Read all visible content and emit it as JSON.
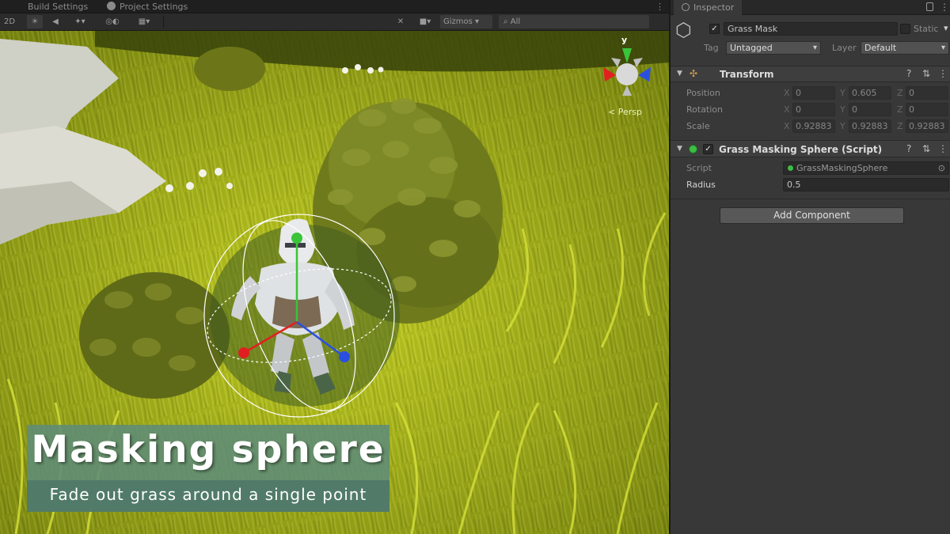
{
  "tabs": {
    "build_settings": "Build Settings",
    "project_settings": "Project Settings"
  },
  "scene_toolbar": {
    "mode_2d": "2D",
    "gizmos": "Gizmos",
    "search_placeholder": "All",
    "persp_label": "< Persp",
    "axis_y": "y"
  },
  "caption": {
    "title": "Masking sphere",
    "subtitle": "Fade out grass around a single point"
  },
  "inspector": {
    "tab_label": "Inspector",
    "object_name": "Grass Mask",
    "static_label": "Static",
    "tag_label": "Tag",
    "tag_value": "Untagged",
    "layer_label": "Layer",
    "layer_value": "Default",
    "transform": {
      "title": "Transform",
      "position_label": "Position",
      "rotation_label": "Rotation",
      "scale_label": "Scale",
      "position": {
        "x": "0",
        "y": "0.605",
        "z": "0"
      },
      "rotation": {
        "x": "0",
        "y": "0",
        "z": "0"
      },
      "scale": {
        "x": "0.92883",
        "y": "0.92883",
        "z": "0.92883"
      }
    },
    "component": {
      "title": "Grass Masking Sphere (Script)",
      "script_label": "Script",
      "script_value": "GrassMaskingSphere",
      "radius_label": "Radius",
      "radius_value": "0.5"
    },
    "add_component": "Add Component"
  },
  "colors": {
    "grass_light": "#c9d426",
    "grass_dark": "#6e7a10",
    "caption_bg": "#5f8c78",
    "inspector_bg": "#383838",
    "gizmo_x": "#e02020",
    "gizmo_y": "#39c43a",
    "gizmo_z": "#2a4fe0"
  }
}
